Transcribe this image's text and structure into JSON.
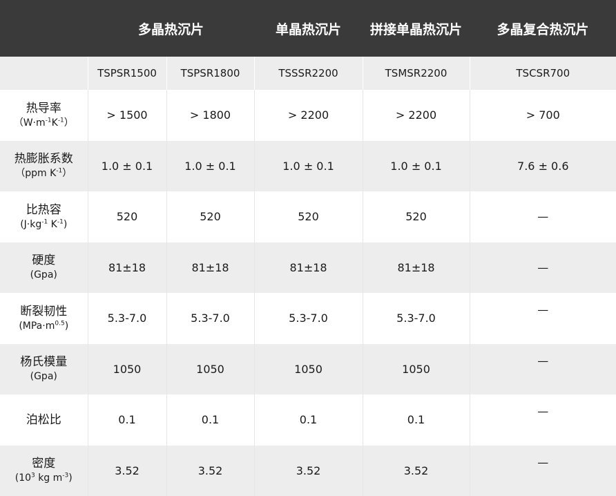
{
  "groups": [
    "多晶热沉片",
    "单晶热沉片",
    "拼接单晶热沉片",
    "多晶复合热沉片"
  ],
  "models": [
    "TSPSR1500",
    "TSPSR1800",
    "TSSSR2200",
    "TSMSR2200",
    "TSCSR700"
  ],
  "rows": [
    {
      "name": "热导率",
      "unit_parts": [
        "（W·m",
        "-1",
        "K",
        "-1",
        "）"
      ],
      "values": [
        "> 1500",
        "> 1800",
        "> 2200",
        "> 2200",
        "> 700"
      ]
    },
    {
      "name": "热膨胀系数",
      "unit_parts": [
        "（ppm K",
        "-1",
        "）"
      ],
      "values": [
        "1.0 ± 0.1",
        "1.0 ± 0.1",
        "1.0 ± 0.1",
        "1.0 ± 0.1",
        "7.6 ± 0.6"
      ]
    },
    {
      "name": "比热容",
      "unit_parts": [
        "(J·kg",
        "-1",
        " K",
        "-1",
        ")"
      ],
      "values": [
        "520",
        "520",
        "520",
        "520",
        "—"
      ]
    },
    {
      "name": "硬度",
      "unit_parts": [
        "(Gpa)"
      ],
      "values": [
        "81±18",
        "81±18",
        "81±18",
        "81±18",
        "—"
      ]
    },
    {
      "name": "断裂韧性",
      "unit_parts": [
        "(MPa·m",
        "0.5",
        ")"
      ],
      "values": [
        "5.3-7.0",
        "5.3-7.0",
        "5.3-7.0",
        "5.3-7.0",
        "—"
      ]
    },
    {
      "name": "杨氏模量",
      "unit_parts": [
        "(Gpa)"
      ],
      "values": [
        "1050",
        "1050",
        "1050",
        "1050",
        "—"
      ]
    },
    {
      "name": "泊松比",
      "unit_parts": [],
      "values": [
        "0.1",
        "0.1",
        "0.1",
        "0.1",
        "—"
      ]
    },
    {
      "name": "密度",
      "unit_parts": [
        "(10",
        "3",
        " kg m",
        "-3",
        ")"
      ],
      "values": [
        "3.52",
        "3.52",
        "3.52",
        "3.52",
        "—"
      ]
    }
  ]
}
